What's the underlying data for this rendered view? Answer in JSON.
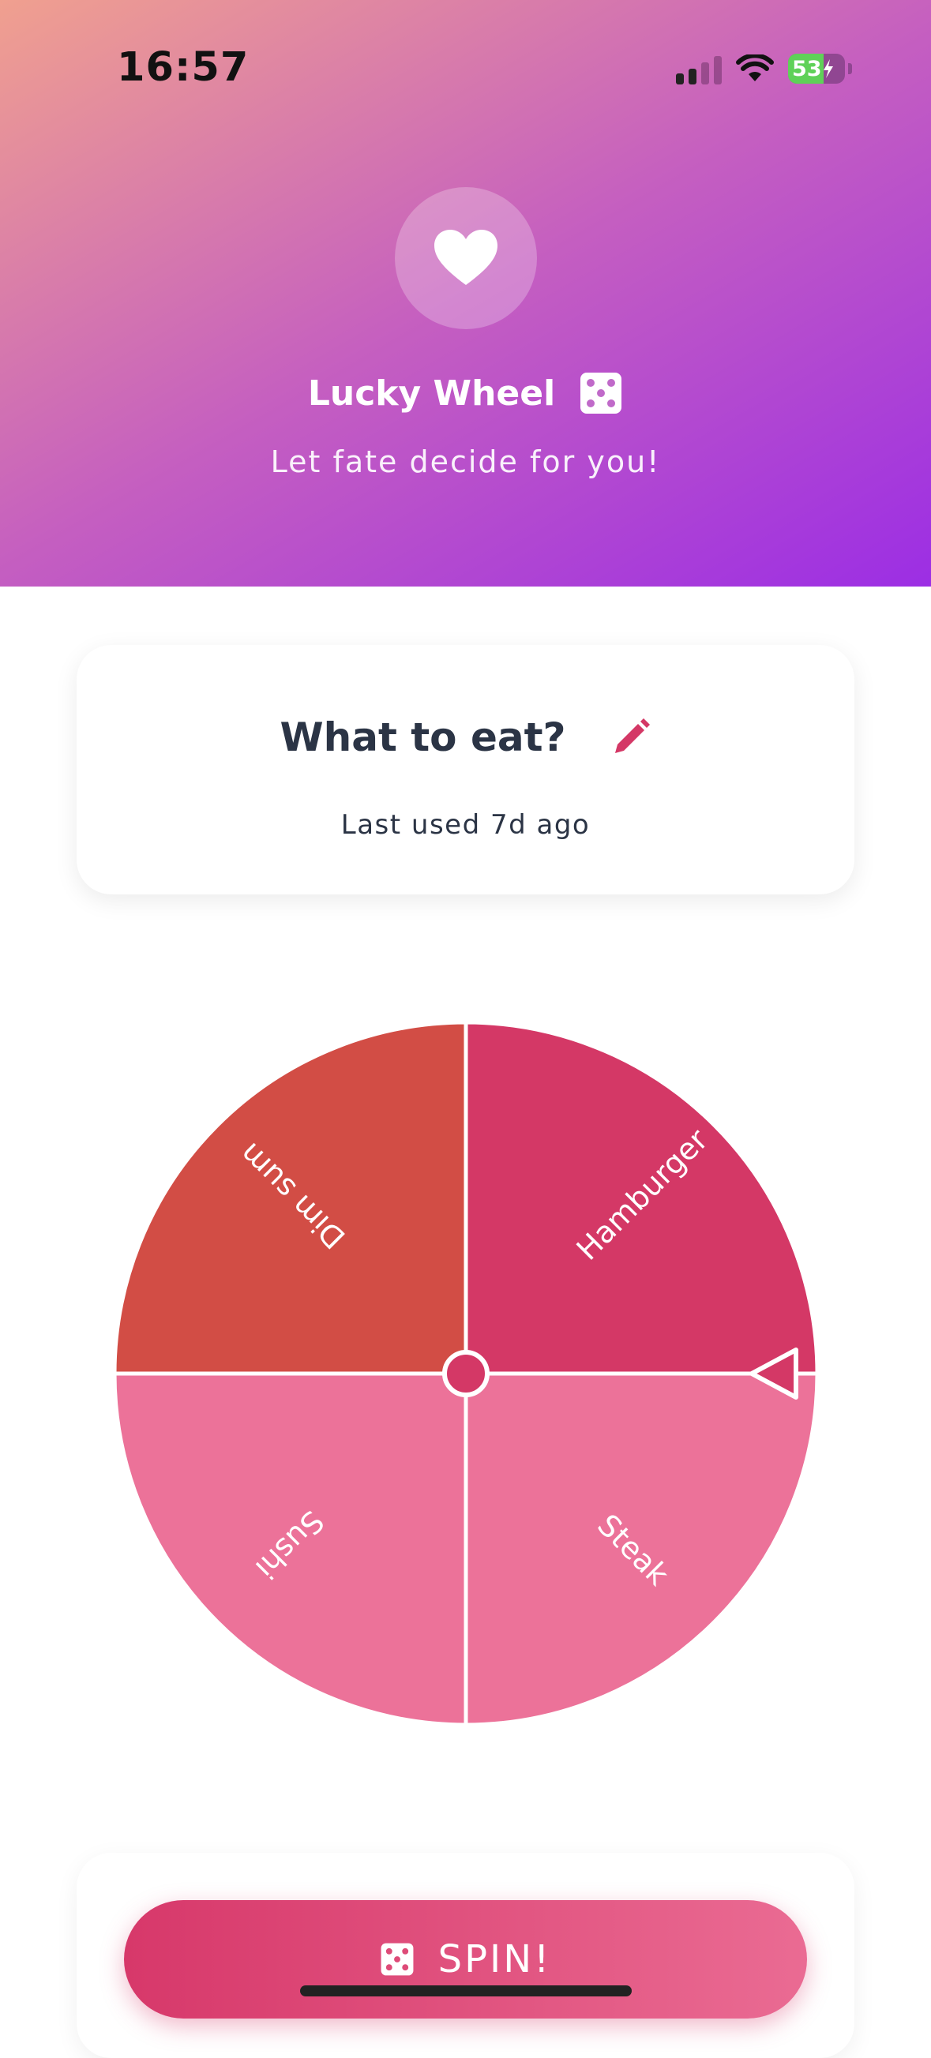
{
  "status_bar": {
    "time": "16:57",
    "battery": "53"
  },
  "header": {
    "title": "Lucky Wheel",
    "subtitle": "Let fate decide for you!",
    "icons": [
      "heart-icon",
      "dice-icon"
    ]
  },
  "wheel_card": {
    "title": "What to eat?",
    "last_used": "Last used 7d ago",
    "edit_icon": "pencil-icon"
  },
  "wheel": {
    "segments": [
      {
        "label": "Hamburger",
        "color": "#d43866"
      },
      {
        "label": "Steak",
        "color": "#ec7299"
      },
      {
        "label": "Sushi",
        "color": "#ec7299"
      },
      {
        "label": "Dim sum",
        "color": "#d24d45"
      }
    ],
    "pointer_icon": "triangle-pointer-icon"
  },
  "spin": {
    "label": "SPIN!",
    "icon": "dice-icon"
  },
  "colors": {
    "accent": "#d43866",
    "header_gradient_start": "#f0a08f",
    "header_gradient_end": "#9c2ee4",
    "text_dark": "#2b3445"
  }
}
